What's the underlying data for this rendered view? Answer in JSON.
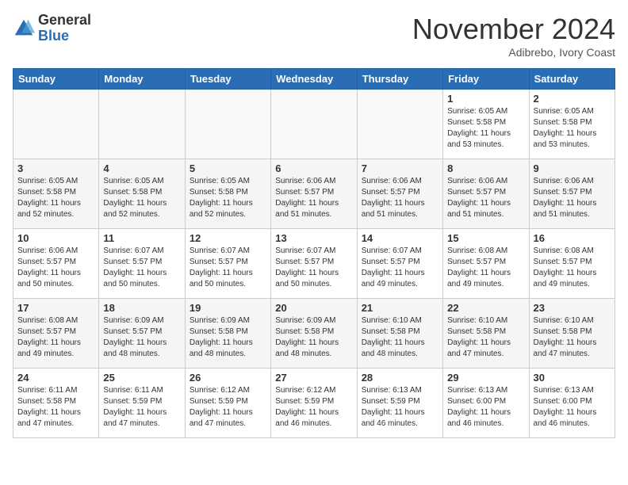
{
  "header": {
    "logo_general": "General",
    "logo_blue": "Blue",
    "month_title": "November 2024",
    "location": "Adibrebo, Ivory Coast"
  },
  "weekdays": [
    "Sunday",
    "Monday",
    "Tuesday",
    "Wednesday",
    "Thursday",
    "Friday",
    "Saturday"
  ],
  "weeks": [
    [
      {
        "day": "",
        "info": ""
      },
      {
        "day": "",
        "info": ""
      },
      {
        "day": "",
        "info": ""
      },
      {
        "day": "",
        "info": ""
      },
      {
        "day": "",
        "info": ""
      },
      {
        "day": "1",
        "info": "Sunrise: 6:05 AM\nSunset: 5:58 PM\nDaylight: 11 hours\nand 53 minutes."
      },
      {
        "day": "2",
        "info": "Sunrise: 6:05 AM\nSunset: 5:58 PM\nDaylight: 11 hours\nand 53 minutes."
      }
    ],
    [
      {
        "day": "3",
        "info": "Sunrise: 6:05 AM\nSunset: 5:58 PM\nDaylight: 11 hours\nand 52 minutes."
      },
      {
        "day": "4",
        "info": "Sunrise: 6:05 AM\nSunset: 5:58 PM\nDaylight: 11 hours\nand 52 minutes."
      },
      {
        "day": "5",
        "info": "Sunrise: 6:05 AM\nSunset: 5:58 PM\nDaylight: 11 hours\nand 52 minutes."
      },
      {
        "day": "6",
        "info": "Sunrise: 6:06 AM\nSunset: 5:57 PM\nDaylight: 11 hours\nand 51 minutes."
      },
      {
        "day": "7",
        "info": "Sunrise: 6:06 AM\nSunset: 5:57 PM\nDaylight: 11 hours\nand 51 minutes."
      },
      {
        "day": "8",
        "info": "Sunrise: 6:06 AM\nSunset: 5:57 PM\nDaylight: 11 hours\nand 51 minutes."
      },
      {
        "day": "9",
        "info": "Sunrise: 6:06 AM\nSunset: 5:57 PM\nDaylight: 11 hours\nand 51 minutes."
      }
    ],
    [
      {
        "day": "10",
        "info": "Sunrise: 6:06 AM\nSunset: 5:57 PM\nDaylight: 11 hours\nand 50 minutes."
      },
      {
        "day": "11",
        "info": "Sunrise: 6:07 AM\nSunset: 5:57 PM\nDaylight: 11 hours\nand 50 minutes."
      },
      {
        "day": "12",
        "info": "Sunrise: 6:07 AM\nSunset: 5:57 PM\nDaylight: 11 hours\nand 50 minutes."
      },
      {
        "day": "13",
        "info": "Sunrise: 6:07 AM\nSunset: 5:57 PM\nDaylight: 11 hours\nand 50 minutes."
      },
      {
        "day": "14",
        "info": "Sunrise: 6:07 AM\nSunset: 5:57 PM\nDaylight: 11 hours\nand 49 minutes."
      },
      {
        "day": "15",
        "info": "Sunrise: 6:08 AM\nSunset: 5:57 PM\nDaylight: 11 hours\nand 49 minutes."
      },
      {
        "day": "16",
        "info": "Sunrise: 6:08 AM\nSunset: 5:57 PM\nDaylight: 11 hours\nand 49 minutes."
      }
    ],
    [
      {
        "day": "17",
        "info": "Sunrise: 6:08 AM\nSunset: 5:57 PM\nDaylight: 11 hours\nand 49 minutes."
      },
      {
        "day": "18",
        "info": "Sunrise: 6:09 AM\nSunset: 5:57 PM\nDaylight: 11 hours\nand 48 minutes."
      },
      {
        "day": "19",
        "info": "Sunrise: 6:09 AM\nSunset: 5:58 PM\nDaylight: 11 hours\nand 48 minutes."
      },
      {
        "day": "20",
        "info": "Sunrise: 6:09 AM\nSunset: 5:58 PM\nDaylight: 11 hours\nand 48 minutes."
      },
      {
        "day": "21",
        "info": "Sunrise: 6:10 AM\nSunset: 5:58 PM\nDaylight: 11 hours\nand 48 minutes."
      },
      {
        "day": "22",
        "info": "Sunrise: 6:10 AM\nSunset: 5:58 PM\nDaylight: 11 hours\nand 47 minutes."
      },
      {
        "day": "23",
        "info": "Sunrise: 6:10 AM\nSunset: 5:58 PM\nDaylight: 11 hours\nand 47 minutes."
      }
    ],
    [
      {
        "day": "24",
        "info": "Sunrise: 6:11 AM\nSunset: 5:58 PM\nDaylight: 11 hours\nand 47 minutes."
      },
      {
        "day": "25",
        "info": "Sunrise: 6:11 AM\nSunset: 5:59 PM\nDaylight: 11 hours\nand 47 minutes."
      },
      {
        "day": "26",
        "info": "Sunrise: 6:12 AM\nSunset: 5:59 PM\nDaylight: 11 hours\nand 47 minutes."
      },
      {
        "day": "27",
        "info": "Sunrise: 6:12 AM\nSunset: 5:59 PM\nDaylight: 11 hours\nand 46 minutes."
      },
      {
        "day": "28",
        "info": "Sunrise: 6:13 AM\nSunset: 5:59 PM\nDaylight: 11 hours\nand 46 minutes."
      },
      {
        "day": "29",
        "info": "Sunrise: 6:13 AM\nSunset: 6:00 PM\nDaylight: 11 hours\nand 46 minutes."
      },
      {
        "day": "30",
        "info": "Sunrise: 6:13 AM\nSunset: 6:00 PM\nDaylight: 11 hours\nand 46 minutes."
      }
    ]
  ]
}
